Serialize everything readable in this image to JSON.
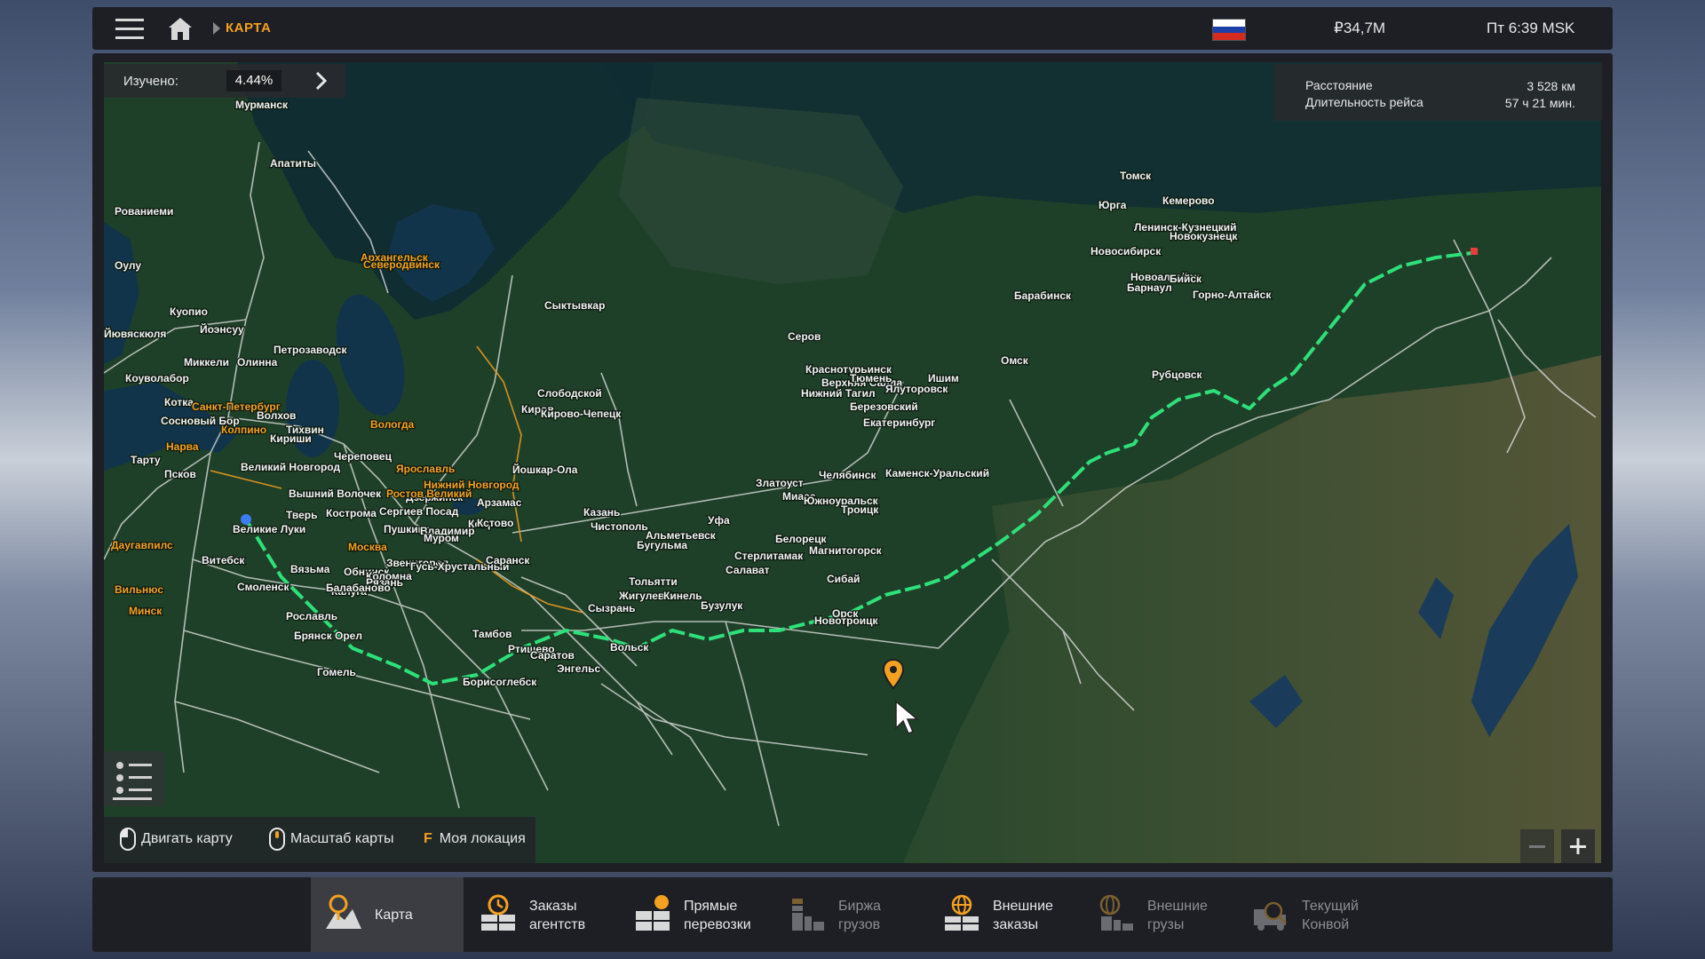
{
  "topbar": {
    "breadcrumb": "КАРТА",
    "money": "₽34,7M",
    "clock": "Пт 6:39 MSK",
    "flag_colors": [
      "#ffffff",
      "#1c3fa8",
      "#d52b1e"
    ]
  },
  "explored": {
    "label": "Изучено:",
    "value": "4.44%"
  },
  "trip": {
    "distance_label": "Расстояние",
    "distance_value": "3 528 км",
    "duration_label": "Длительность рейса",
    "duration_value": "57 ч 21 мин."
  },
  "hints": {
    "move": "Двигать карту",
    "zoom": "Масштаб карты",
    "location_key": "F",
    "location": "Моя локация"
  },
  "colors": {
    "accent": "#f4a020",
    "route": "#2ee07a",
    "road": "#e8e8e8"
  },
  "map_labels": [
    {
      "text": "Мурманск",
      "cls": "w"
    },
    {
      "text": "Апатиты",
      "cls": "w"
    },
    {
      "text": "Рованиеми",
      "cls": "w"
    },
    {
      "text": "Архангельск",
      "cls": "o"
    },
    {
      "text": "Северодвинск",
      "cls": "o"
    },
    {
      "text": "Оулу",
      "cls": "w"
    },
    {
      "text": "Куопио",
      "cls": "w"
    },
    {
      "text": "Йоэнсуу",
      "cls": "w"
    },
    {
      "text": "Йювяскюля",
      "cls": "w"
    },
    {
      "text": "Петрозаводск",
      "cls": "w"
    },
    {
      "text": "Миккели",
      "cls": "w"
    },
    {
      "text": "Олинна",
      "cls": "w"
    },
    {
      "text": "Коуволабор",
      "cls": "w"
    },
    {
      "text": "Котка",
      "cls": "w"
    },
    {
      "text": "Санкт-Петербург",
      "cls": "o"
    },
    {
      "text": "Сосновый Бор",
      "cls": "w"
    },
    {
      "text": "Колпино",
      "cls": "o"
    },
    {
      "text": "Волхов",
      "cls": "w"
    },
    {
      "text": "Нарва",
      "cls": "o"
    },
    {
      "text": "Тарту",
      "cls": "w"
    },
    {
      "text": "Псков",
      "cls": "w"
    },
    {
      "text": "Великий Новгород",
      "cls": "w"
    },
    {
      "text": "Кириши",
      "cls": "w"
    },
    {
      "text": "Тихвин",
      "cls": "w"
    },
    {
      "text": "Вологда",
      "cls": "o"
    },
    {
      "text": "Череповец",
      "cls": "w"
    },
    {
      "text": "Ярославль",
      "cls": "o"
    },
    {
      "text": "Сыктывкар",
      "cls": "w"
    },
    {
      "text": "Слободской",
      "cls": "w"
    },
    {
      "text": "Киров",
      "cls": "w"
    },
    {
      "text": "Кирово-Чепецк",
      "cls": "w"
    },
    {
      "text": "Йошкар-Ола",
      "cls": "w"
    },
    {
      "text": "Нижний Новгород",
      "cls": "o"
    },
    {
      "text": "Дзержинск",
      "cls": "w"
    },
    {
      "text": "Ростов Великий",
      "cls": "o"
    },
    {
      "text": "Вышний Волочек",
      "cls": "w"
    },
    {
      "text": "Сергиев Посад",
      "cls": "w"
    },
    {
      "text": "Тверь",
      "cls": "w"
    },
    {
      "text": "Великие Луки",
      "cls": "w"
    },
    {
      "text": "Даугавпилс",
      "cls": "o"
    },
    {
      "text": "Витебск",
      "cls": "w"
    },
    {
      "text": "Вильнюс",
      "cls": "o"
    },
    {
      "text": "Минск",
      "cls": "o"
    },
    {
      "text": "Смоленск",
      "cls": "w"
    },
    {
      "text": "Москва",
      "cls": "o"
    },
    {
      "text": "Звенигород",
      "cls": "w"
    },
    {
      "text": "Обнинск",
      "cls": "w"
    },
    {
      "text": "Калуга",
      "cls": "w"
    },
    {
      "text": "Рославль",
      "cls": "w"
    },
    {
      "text": "Брянск",
      "cls": "w"
    },
    {
      "text": "Орел",
      "cls": "w"
    },
    {
      "text": "Тамбов",
      "cls": "w"
    },
    {
      "text": "Ртищево",
      "cls": "w"
    },
    {
      "text": "Саратов",
      "cls": "w"
    },
    {
      "text": "Энгельс",
      "cls": "w"
    },
    {
      "text": "Вольск",
      "cls": "w"
    },
    {
      "text": "Сызрань",
      "cls": "w"
    },
    {
      "text": "Тольятти",
      "cls": "w"
    },
    {
      "text": "Жигулевск",
      "cls": "w"
    },
    {
      "text": "Бузулук",
      "cls": "w"
    },
    {
      "text": "Казань",
      "cls": "w"
    },
    {
      "text": "Чистополь",
      "cls": "w"
    },
    {
      "text": "Альметьевск",
      "cls": "w"
    },
    {
      "text": "Бугульма",
      "cls": "w"
    },
    {
      "text": "Уфа",
      "cls": "w"
    },
    {
      "text": "Стерлитамак",
      "cls": "w"
    },
    {
      "text": "Салават",
      "cls": "w"
    },
    {
      "text": "Белорецк",
      "cls": "w"
    },
    {
      "text": "Магнитогорск",
      "cls": "w"
    },
    {
      "text": "Сибай",
      "cls": "w"
    },
    {
      "text": "Орск",
      "cls": "w"
    },
    {
      "text": "Новотроицк",
      "cls": "w"
    },
    {
      "text": "Златоуст",
      "cls": "w"
    },
    {
      "text": "Миасс",
      "cls": "w"
    },
    {
      "text": "Южноуральск",
      "cls": "w"
    },
    {
      "text": "Троицк",
      "cls": "w"
    },
    {
      "text": "Челябинск",
      "cls": "w"
    },
    {
      "text": "Каменск-Уральский",
      "cls": "w"
    },
    {
      "text": "Екатеринбург",
      "cls": "w"
    },
    {
      "text": "Березовский",
      "cls": "w"
    },
    {
      "text": "Нижний Тагил",
      "cls": "w"
    },
    {
      "text": "Верхняя Салда",
      "cls": "w"
    },
    {
      "text": "Краснотурьинск",
      "cls": "w"
    },
    {
      "text": "Серов",
      "cls": "w"
    },
    {
      "text": "Тюмень",
      "cls": "w"
    },
    {
      "text": "Ялуторовск",
      "cls": "w"
    },
    {
      "text": "Ишим",
      "cls": "w"
    },
    {
      "text": "Омск",
      "cls": "w"
    },
    {
      "text": "Барабинск",
      "cls": "w"
    },
    {
      "text": "Новосибирск",
      "cls": "w"
    },
    {
      "text": "Томск",
      "cls": "w"
    },
    {
      "text": "Юрга",
      "cls": "w"
    },
    {
      "text": "Кемерово",
      "cls": "w"
    },
    {
      "text": "Ленинск-Кузнецкий",
      "cls": "w"
    },
    {
      "text": "Новокузнецк",
      "cls": "w"
    },
    {
      "text": "Новоалтайск",
      "cls": "w"
    },
    {
      "text": "Барнаул",
      "cls": "w"
    },
    {
      "text": "Бийск",
      "cls": "w"
    },
    {
      "text": "Горно-Алтайск",
      "cls": "w"
    },
    {
      "text": "Рубцовск",
      "cls": "w"
    },
    {
      "text": "Кострома",
      "cls": "w"
    },
    {
      "text": "Пушкино",
      "cls": "w"
    },
    {
      "text": "Владимир",
      "cls": "w"
    },
    {
      "text": "Ковров",
      "cls": "w"
    },
    {
      "text": "Муром",
      "cls": "w"
    },
    {
      "text": "Гусь-Хрустальный",
      "cls": "w"
    },
    {
      "text": "Коломна",
      "cls": "w"
    },
    {
      "text": "Рязань",
      "cls": "w"
    },
    {
      "text": "Балабаново",
      "cls": "w"
    },
    {
      "text": "Саранск",
      "cls": "w"
    },
    {
      "text": "Арзамас",
      "cls": "w"
    },
    {
      "text": "Вязьма",
      "cls": "w"
    },
    {
      "text": "Гомель",
      "cls": "w"
    },
    {
      "text": "Борисоглебск",
      "cls": "w"
    },
    {
      "text": "Кинель",
      "cls": "w"
    },
    {
      "text": "Кстово",
      "cls": "w"
    }
  ],
  "bottom_tabs": [
    {
      "line1": "Карта",
      "line2": "",
      "state": "active",
      "icon": "map-icon"
    },
    {
      "line1": "Заказы",
      "line2": "агентств",
      "state": "normal",
      "icon": "agency-orders-icon"
    },
    {
      "line1": "Прямые",
      "line2": "перевозки",
      "state": "normal",
      "icon": "direct-transport-icon"
    },
    {
      "line1": "Биржа",
      "line2": "грузов",
      "state": "dim",
      "icon": "cargo-exchange-icon"
    },
    {
      "line1": "Внешние",
      "line2": "заказы",
      "state": "normal",
      "icon": "external-orders-icon"
    },
    {
      "line1": "Внешние",
      "line2": "грузы",
      "state": "dim",
      "icon": "external-cargo-icon"
    },
    {
      "line1": "Текущий",
      "line2": "Конвой",
      "state": "dim",
      "icon": "convoy-icon"
    }
  ]
}
